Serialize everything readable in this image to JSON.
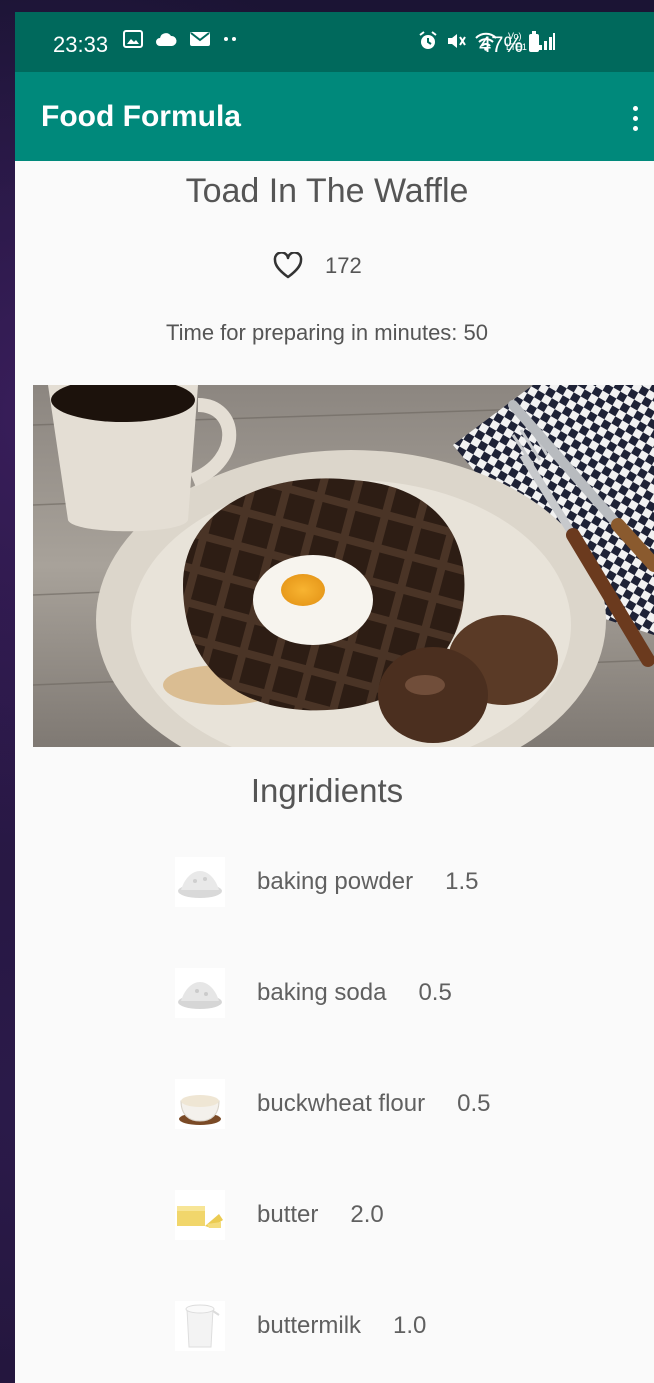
{
  "status_bar": {
    "time": "23:33",
    "battery": "47%",
    "left_icons": [
      "image-icon",
      "cloud-icon",
      "mail-icon",
      "more-dots-icon"
    ],
    "right_icons": [
      "alarm-icon",
      "mute-icon",
      "wifi-icon",
      "volte-icon",
      "signal-icon",
      "battery-icon"
    ]
  },
  "app_bar": {
    "title": "Food Formula",
    "menu_icon": "overflow-menu-icon"
  },
  "recipe": {
    "title": "Toad In The Waffle",
    "likes": "172",
    "prep_time": "Time for preparing in minutes: 50"
  },
  "ingredients": {
    "heading": "Ingridients",
    "items": [
      {
        "name": "baking powder",
        "qty": "1.5"
      },
      {
        "name": "baking soda",
        "qty": "0.5"
      },
      {
        "name": "buckwheat flour",
        "qty": "0.5"
      },
      {
        "name": "butter",
        "qty": "2.0"
      },
      {
        "name": "buttermilk",
        "qty": "1.0"
      }
    ]
  },
  "colors": {
    "status_bar": "#00695c",
    "app_bar": "#00897b",
    "text_gray": "#555555",
    "background": "#fafafa"
  }
}
